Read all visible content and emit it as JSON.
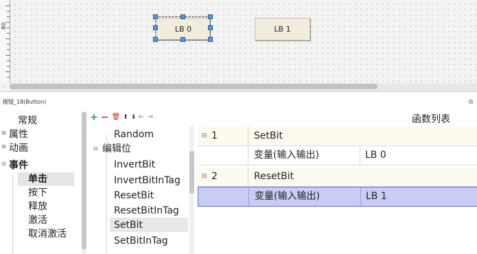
{
  "canvas": {
    "ruler_label": "80",
    "buttons": [
      {
        "label": "LB 0",
        "selected": true
      },
      {
        "label": "LB 1",
        "selected": false
      }
    ]
  },
  "properties": {
    "title": "按钮_18(Button)",
    "restore_icon": "restore-window-icon"
  },
  "categories": [
    {
      "label": "常规",
      "expander": ""
    },
    {
      "label": "属性",
      "expander": "⊞"
    },
    {
      "label": "动画",
      "expander": "⊞"
    },
    {
      "label": "事件",
      "expander": "⊟",
      "bold": true
    },
    {
      "label": "单击",
      "bold": true,
      "selected": true
    },
    {
      "label": "按下"
    },
    {
      "label": "释放"
    },
    {
      "label": "激活"
    },
    {
      "label": "取消激活"
    }
  ],
  "toolbar": {
    "add": "+",
    "remove": "−",
    "delete": "🗑",
    "up": "⬆",
    "down": "⬇",
    "indent": "⇤",
    "outdent": "⇥"
  },
  "function_tree": {
    "items": [
      "Random",
      "编辑位",
      "InvertBit",
      "InvertBitInTag",
      "ResetBit",
      "ResetBitInTag",
      "SetBit",
      "SetBitInTag"
    ],
    "selected": "SetBit"
  },
  "function_list": {
    "title": "函数列表",
    "rows": [
      {
        "num": "1",
        "name": "SetBit",
        "param": "变量(输入输出)",
        "value": "LB 0"
      },
      {
        "num": "2",
        "name": "ResetBit",
        "param": "变量(输入输出)",
        "value": "LB 1"
      }
    ]
  },
  "colors": {
    "selected_row": "#c9cdf2",
    "accent": "#5a6ed8",
    "toolbar_add": "#2e9c3a",
    "toolbar_delete": "#d12c2c"
  }
}
